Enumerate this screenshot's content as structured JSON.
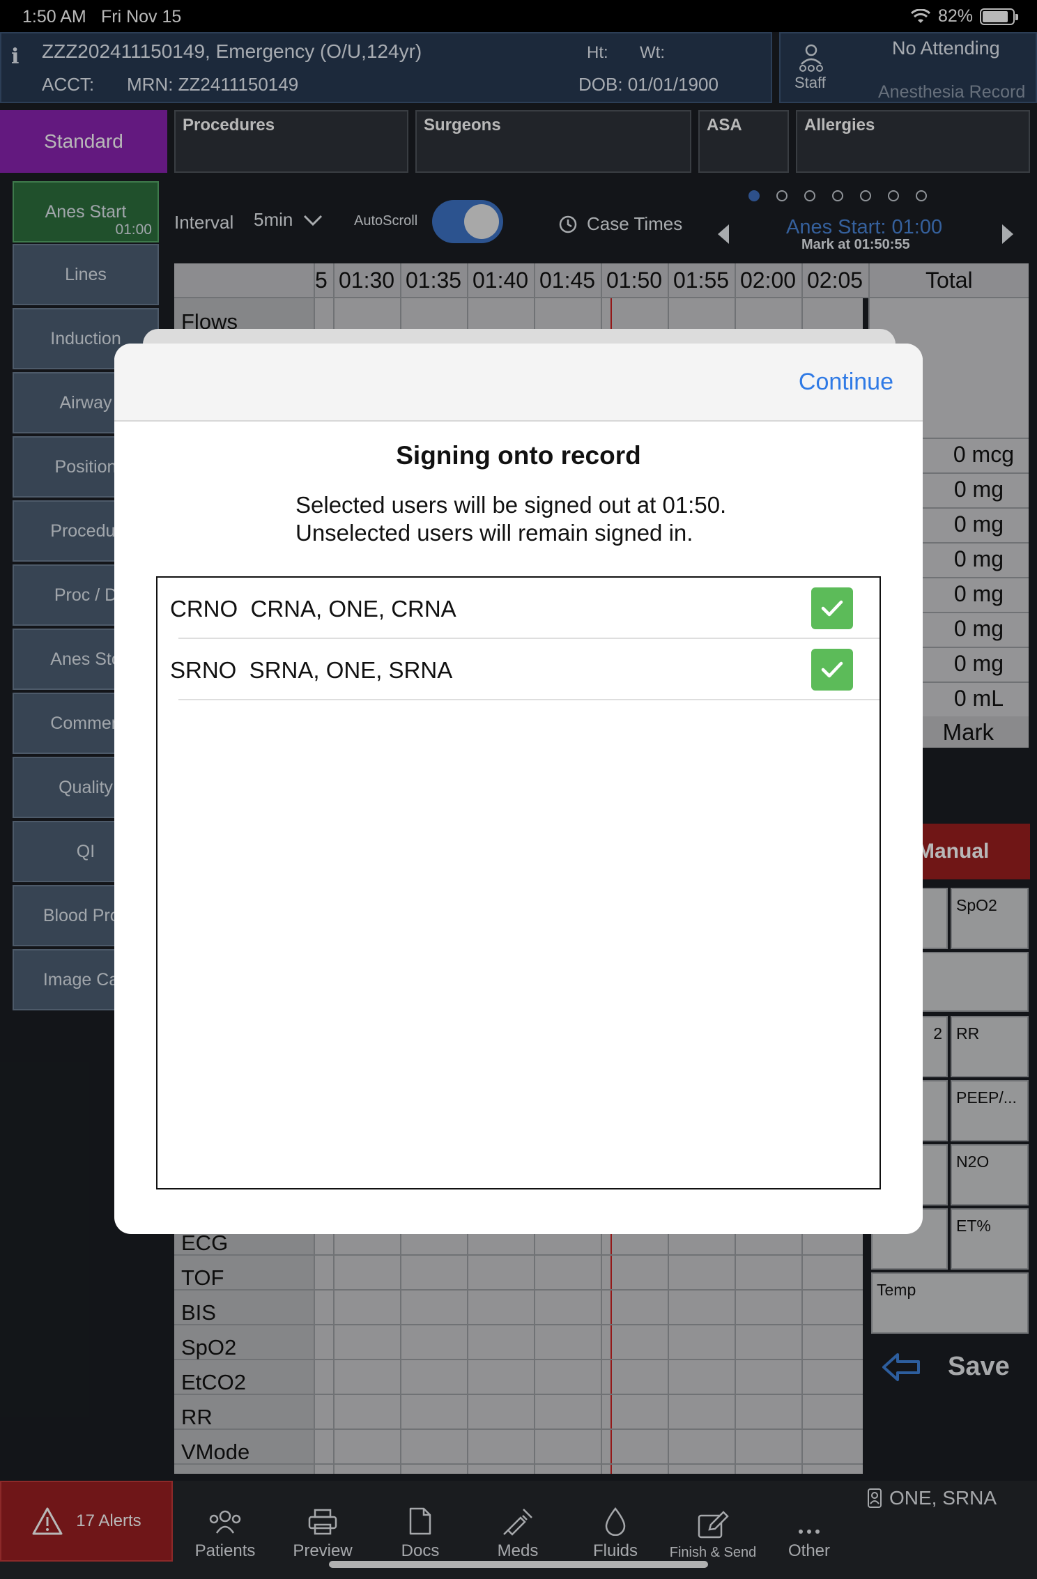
{
  "status_bar": {
    "time": "1:50 AM",
    "date": "Fri Nov 15",
    "battery": "82%"
  },
  "patient": {
    "name_line": "ZZZ202411150149, Emergency (O/U,124yr)",
    "acct_label": "ACCT:",
    "mrn": "MRN: ZZ2411150149",
    "ht_label": "Ht:",
    "wt_label": "Wt:",
    "dob": "DOB: 01/01/1900"
  },
  "staff": {
    "label": "Staff",
    "attending": "No Attending",
    "record": "Anesthesia Record"
  },
  "categories": {
    "standard": "Standard",
    "procedures": "Procedures",
    "surgeons": "Surgeons",
    "asa": "ASA",
    "allergies": "Allergies"
  },
  "left_nav": [
    {
      "label": "Anes Start",
      "sub": "01:00"
    },
    {
      "label": "Lines"
    },
    {
      "label": "Induction"
    },
    {
      "label": "Airway"
    },
    {
      "label": "Position"
    },
    {
      "label": "Procedur"
    },
    {
      "label": "Proc / D"
    },
    {
      "label": "Anes Sto"
    },
    {
      "label": "Commen"
    },
    {
      "label": "Quality"
    },
    {
      "label": "QI"
    },
    {
      "label": "Blood Proc"
    },
    {
      "label": "Image Cap"
    }
  ],
  "controls": {
    "interval_label": "Interval",
    "interval_value": "5min",
    "autoscroll_label": "AutoScroll",
    "autoscroll_on": true,
    "case_times": "Case Times",
    "anes_start": "Anes Start: 01:00",
    "mark_at": "Mark at 01:50:55",
    "page_dots": 7,
    "active_dot": 0
  },
  "grid": {
    "times": [
      "5",
      "01:30",
      "01:35",
      "01:40",
      "01:45",
      "01:50",
      "01:55",
      "02:00",
      "02:05"
    ],
    "total_header": "Total",
    "top_row": "Flows",
    "totals": [
      "0 mcg",
      "0 mg",
      "0 mg",
      "0 mg",
      "0 mg",
      "0 mg",
      "0 mg",
      "0 mL"
    ],
    "mark": "Mark",
    "bottom_rows": [
      "ECG",
      "TOF",
      "BIS",
      "SpO2",
      "EtCO2",
      "RR",
      "VMode"
    ]
  },
  "vitals_panel": {
    "manual": "Manual",
    "tiles": [
      "SpO2",
      "2",
      "RR",
      "PEEP/...",
      "N2O",
      "ET%",
      "Temp"
    ],
    "save": "Save"
  },
  "bottom_bar": {
    "alerts": "17 Alerts",
    "tabs": [
      "Patients",
      "Preview",
      "Docs",
      "Meds",
      "Fluids",
      "Finish & Send",
      "Other"
    ],
    "user": "ONE, SRNA"
  },
  "modal": {
    "continue": "Continue",
    "title": "Signing onto record",
    "desc_line1": "Selected users will be signed out at 01:50.",
    "desc_line2": "Unselected users will remain signed in.",
    "users": [
      {
        "text": "CRNO  CRNA, ONE, CRNA",
        "checked": true
      },
      {
        "text": "SRNO  SRNA, ONE, SRNA",
        "checked": true
      }
    ]
  },
  "colors": {
    "accent": "#2f7ae5",
    "check": "#5cbb59",
    "standard": "#8a23b0",
    "alert": "#9a1f22"
  }
}
